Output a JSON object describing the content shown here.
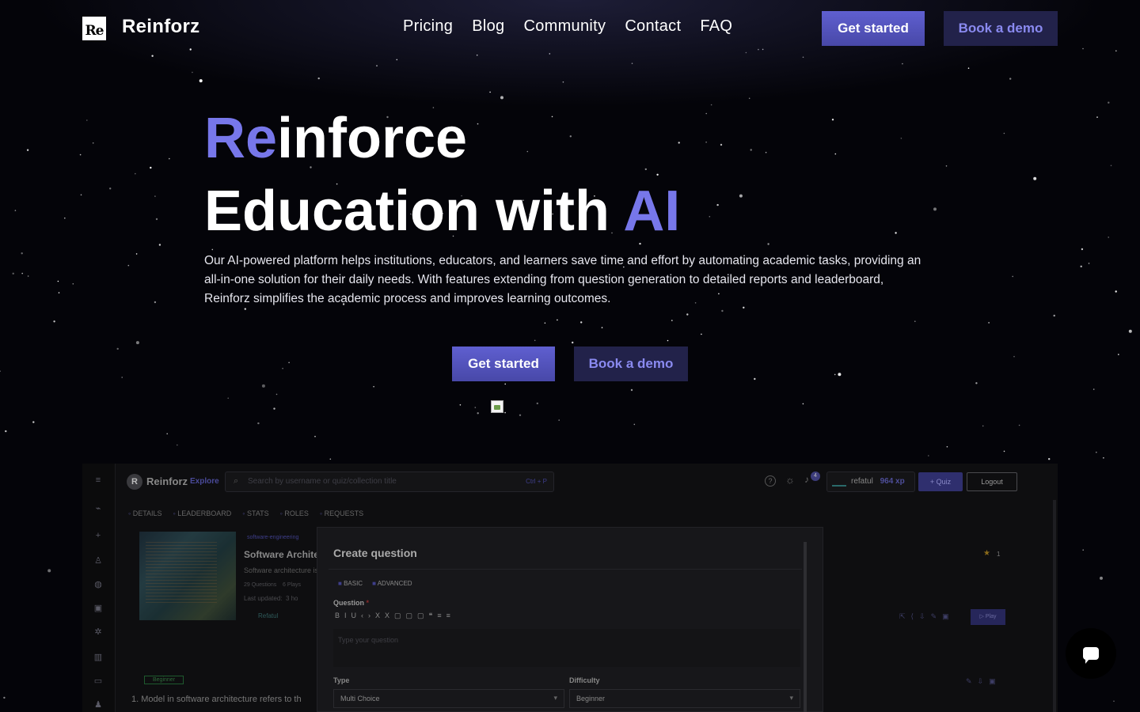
{
  "nav": {
    "logo_text": "Re",
    "brand": "Reinforz",
    "links": [
      "Pricing",
      "Blog",
      "Community",
      "Contact",
      "FAQ"
    ],
    "get_started": "Get started",
    "book_demo": "Book a demo"
  },
  "hero": {
    "line1_accent": "Re",
    "line1_rest": "inforce",
    "line2_main": "Education with ",
    "line2_accent": "AI",
    "description": "Our AI-powered platform helps institutions, educators, and learners save time and effort by automating academic tasks, providing an all-in-one solution for their daily needs. With features extending from question generation to detailed reports and leaderboard, Reinforz simplifies the academic process and improves learning outcomes.",
    "get_started": "Get started",
    "book_demo": "Book a demo"
  },
  "preview": {
    "logo_letter": "R",
    "brand": "Reinforz",
    "explore": "Explore",
    "search_placeholder": "Search by username or quiz/collection title",
    "search_shortcut": "Ctrl + P",
    "username": "refatul",
    "xp": "964 xp",
    "notification_count": "4",
    "quiz_button": "+ Quiz",
    "logout_button": "Logout",
    "tabs": [
      "DETAILS",
      "LEADERBOARD",
      "STATS",
      "ROLES",
      "REQUESTS"
    ],
    "course": {
      "tag": "software-engineering",
      "title": "Software Archite",
      "subtitle": "Software architecture is",
      "questions": "29 Questions",
      "plays": "6 Plays",
      "updated_label": "Last updated:",
      "updated_value": "3 ho",
      "author": "Refatul"
    },
    "star_count": "1",
    "play_button": "Play",
    "difficulty_badge": "Beginner",
    "question_row": "1.  Model in software architecture refers to th",
    "modal": {
      "title": "Create question",
      "tab_basic": "BASIC",
      "tab_advanced": "ADVANCED",
      "question_label": "Question",
      "required_mark": "*",
      "question_placeholder": "Type your question",
      "type_label": "Type",
      "type_value": "Multi Choice",
      "difficulty_label": "Difficulty",
      "difficulty_value": "Beginner"
    }
  },
  "colors": {
    "background": "#040409",
    "accent": "#7777ea",
    "button_primary": "#5656bc",
    "button_secondary": "#22224a"
  }
}
